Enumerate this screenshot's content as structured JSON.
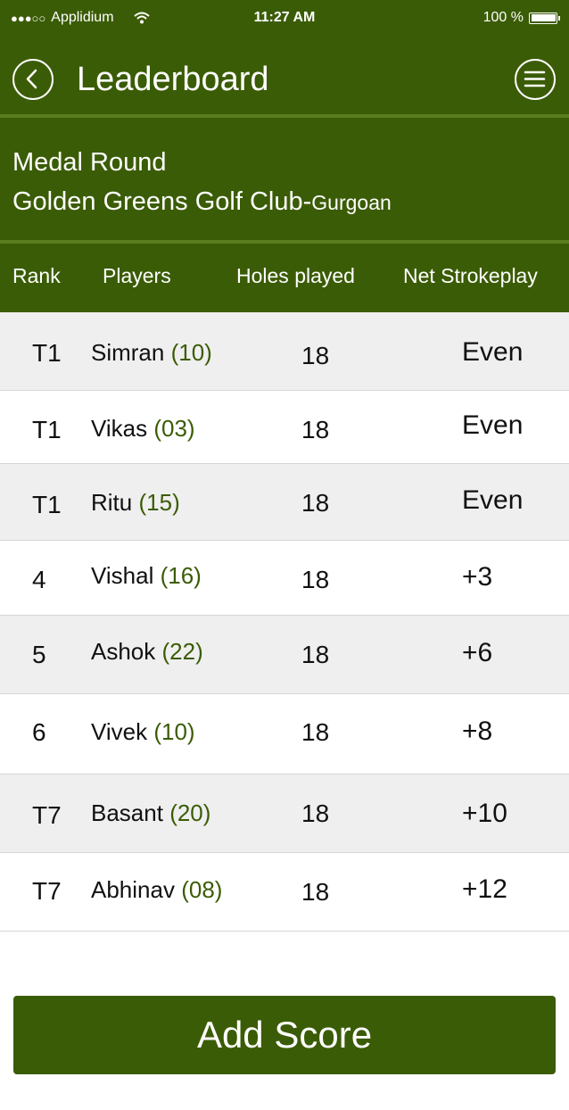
{
  "status_bar": {
    "carrier": "Applidium",
    "time": "11:27 AM",
    "battery": "100 %"
  },
  "nav": {
    "title": "Leaderboard",
    "back_icon": "chevron-left-icon",
    "menu_icon": "hamburger-menu-icon"
  },
  "round": {
    "name": "Medal Round",
    "club": "Golden Greens Golf Club-",
    "city": "Gurgoan"
  },
  "columns": {
    "rank": "Rank",
    "players": "Players",
    "holes": "Holes played",
    "score": "Net Strokeplay"
  },
  "rows": [
    {
      "rank": "T1",
      "player": "Simran",
      "handicap": "(10)",
      "holes": "18",
      "score": "Even"
    },
    {
      "rank": "T1",
      "player": "Vikas",
      "handicap": "(03)",
      "holes": "18",
      "score": "Even"
    },
    {
      "rank": "T1",
      "player": "Ritu",
      "handicap": "(15)",
      "holes": "18",
      "score": "Even"
    },
    {
      "rank": "4",
      "player": "Vishal",
      "handicap": "(16)",
      "holes": "18",
      "score": "+3"
    },
    {
      "rank": "5",
      "player": "Ashok",
      "handicap": "(22)",
      "holes": "18",
      "score": "+6"
    },
    {
      "rank": "6",
      "player": "Vivek",
      "handicap": "(10)",
      "holes": "18",
      "score": "+8"
    },
    {
      "rank": "T7",
      "player": "Basant",
      "handicap": "(20)",
      "holes": "18",
      "score": "+10"
    },
    {
      "rank": "T7",
      "player": "Abhinav",
      "handicap": "(08)",
      "holes": "18",
      "score": "+12"
    }
  ],
  "add_score_label": "Add Score",
  "colors": {
    "brand_green": "#3b5c06",
    "divider_green": "#5b7d20",
    "row_shade": "#efefef"
  }
}
